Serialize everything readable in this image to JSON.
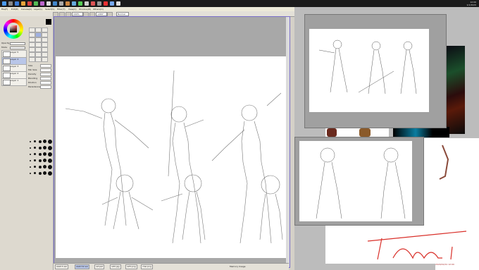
{
  "app": {
    "title": "PaintTool SAI"
  },
  "taskbar": {
    "clock": "12:00",
    "date": "1/1/2020"
  },
  "menu": [
    {
      "label": "File(F)"
    },
    {
      "label": "Edit(E)"
    },
    {
      "label": "Canvas(C)"
    },
    {
      "label": "Layer(L)"
    },
    {
      "label": "Select(S)"
    },
    {
      "label": "Filter(T)"
    },
    {
      "label": "View(V)"
    },
    {
      "label": "Window(W)"
    },
    {
      "label": "Others(O)"
    }
  ],
  "toolbar": {
    "zoom": "100%",
    "angle": "+000°",
    "mode": "Normal"
  },
  "color_panel": {
    "sliders": [
      {
        "label": "Opacity"
      },
      {
        "label": "Mode"
      }
    ],
    "layers": [
      {
        "label": "Layer 5"
      },
      {
        "label": "Layer 4"
      },
      {
        "label": "Layer 3"
      },
      {
        "label": "Layer 2"
      },
      {
        "label": "Layer 1"
      }
    ]
  },
  "tool_panel": {
    "props": [
      {
        "label": "Size"
      },
      {
        "label": "Min Size"
      },
      {
        "label": "Density"
      },
      {
        "label": "Blending"
      },
      {
        "label": "Dilution"
      },
      {
        "label": "Persistence"
      }
    ]
  },
  "status": {
    "tabs": [
      {
        "label": "sketch.sai"
      },
      {
        "label": "sketch2.sai"
      },
      {
        "label": "ref.psd"
      },
      {
        "label": "ref2.jpg"
      },
      {
        "label": "ref3.png"
      },
      {
        "label": "char.png"
      }
    ],
    "memory": "Memory Usage"
  },
  "bottom_right": {
    "text": "2020/01/01 12:00"
  },
  "colors": {
    "accent": "#7a6fc9",
    "selection": "#b9c6e8",
    "notes_ink": "#d9302a"
  }
}
